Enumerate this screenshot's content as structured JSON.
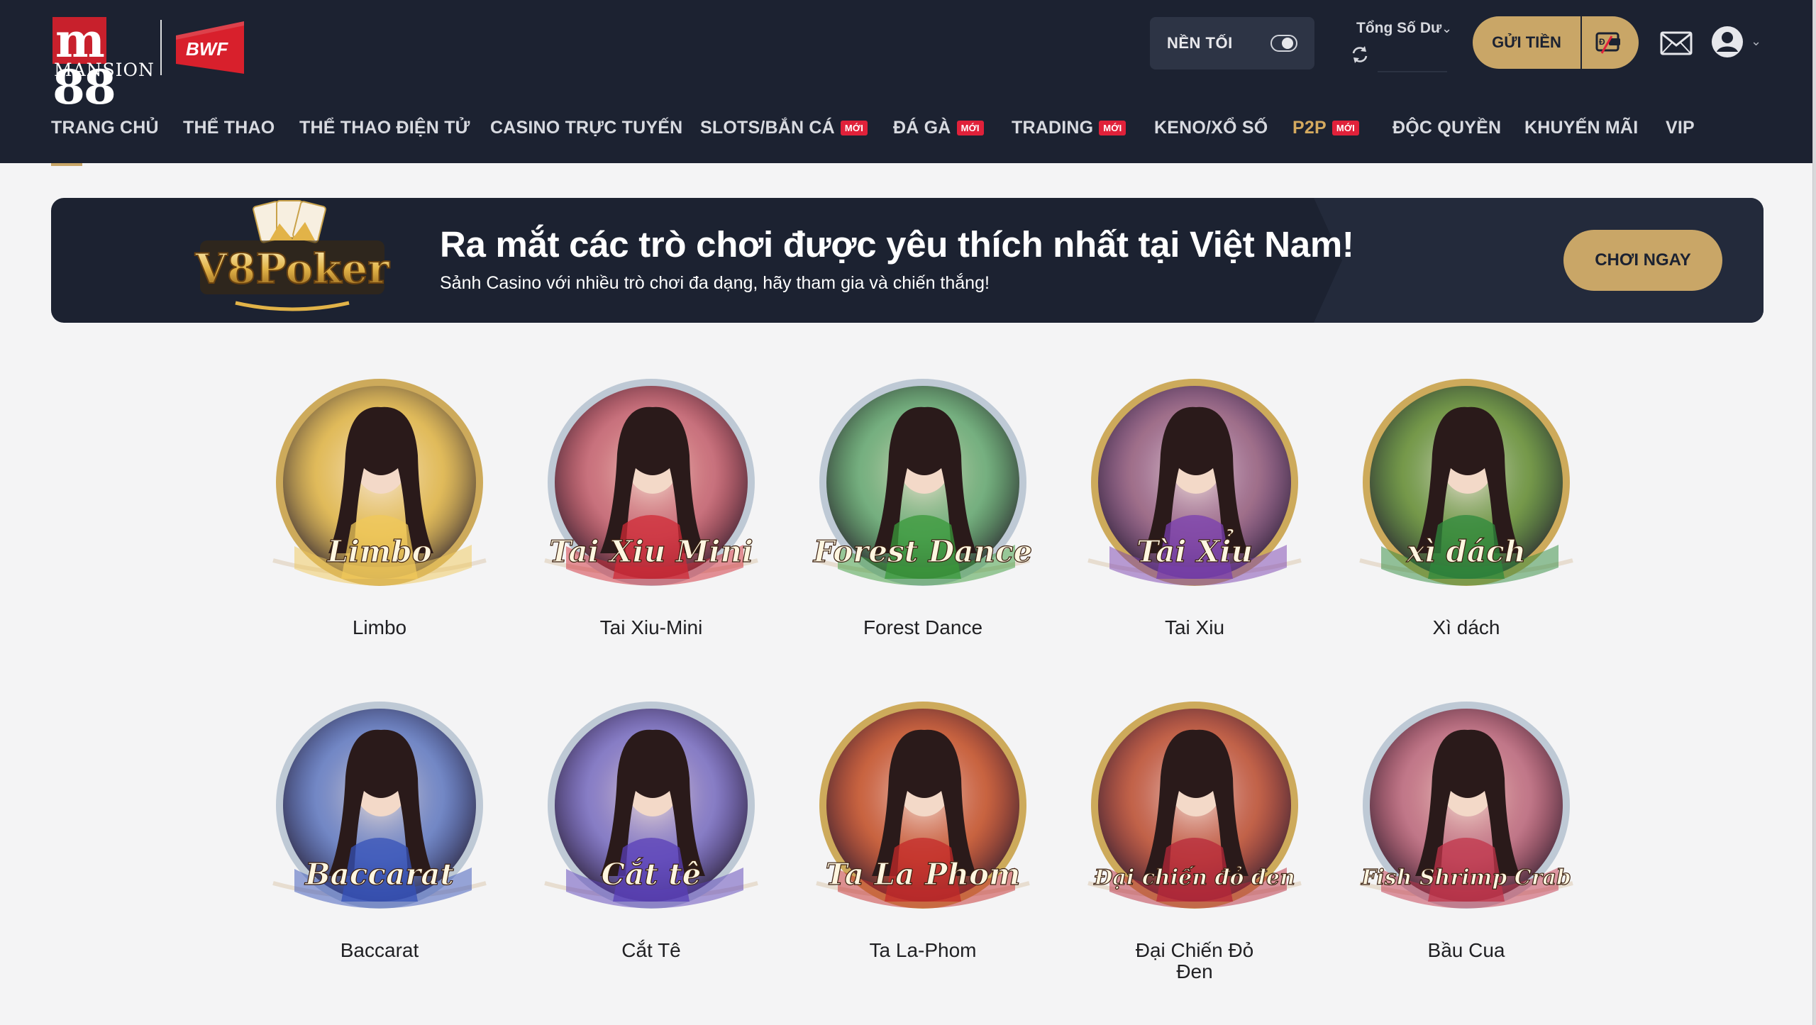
{
  "header": {
    "brand_main": "88",
    "brand_m": "m",
    "brand_sub": "MANSION",
    "partner_logo": "BWF",
    "dark_mode_label": "NỀN TỐI",
    "dark_mode_on": false,
    "balance_label": "Tổng Số Dư",
    "deposit_label": "GỬI TIỀN"
  },
  "nav": {
    "items": [
      {
        "label": "TRANG CHỦ",
        "new": false,
        "active": true
      },
      {
        "label": "THỂ THAO",
        "new": false
      },
      {
        "label": "THỂ THAO ĐIỆN TỬ",
        "new": false
      },
      {
        "label": "CASINO TRỰC TUYẾN",
        "new": false
      },
      {
        "label": "SLOTS/BẮN CÁ",
        "new": true
      },
      {
        "label": "ĐÁ GÀ",
        "new": true
      },
      {
        "label": "TRADING",
        "new": true
      },
      {
        "label": "KENO/XỔ SỐ",
        "new": false
      },
      {
        "label": "P2P",
        "new": true,
        "highlight": true
      },
      {
        "label": "ĐỘC QUYỀN",
        "new": false
      },
      {
        "label": "KHUYẾN MÃI",
        "new": false
      },
      {
        "label": "VIP",
        "new": false
      }
    ],
    "new_badge": "MỚI"
  },
  "banner": {
    "logo_text": "V8Poker",
    "headline": "Ra mắt các trò chơi được yêu thích nhất tại Việt Nam!",
    "subline": "Sảnh Casino với nhiều trò chơi đa dạng, hãy tham gia và chiến thắng!",
    "cta": "CHƠI NGAY"
  },
  "games": [
    {
      "name": "Limbo",
      "art_text": "Limbo",
      "ring": "#c9a24a",
      "glow": "#f0c85a"
    },
    {
      "name": "Tai Xiu-Mini",
      "art_text": "Tai Xiu Mini",
      "ring": "#b8c4d2",
      "glow": "#d02a35"
    },
    {
      "name": "Forest Dance",
      "art_text": "Forest Dance",
      "ring": "#b8c4d2",
      "glow": "#3a9a3a"
    },
    {
      "name": "Tai Xiu",
      "art_text": "Tài Xỉu",
      "ring": "#c9a24a",
      "glow": "#7a3fb0"
    },
    {
      "name": "Xì dách",
      "art_text": "xì dách",
      "ring": "#c9a24a",
      "glow": "#2e8a3c"
    },
    {
      "name": "Baccarat",
      "art_text": "Baccarat",
      "ring": "#b8c4d2",
      "glow": "#3552b8"
    },
    {
      "name": "Cắt Tê",
      "art_text": "Cắt tê",
      "ring": "#b8c4d2",
      "glow": "#5a3fb8"
    },
    {
      "name": "Ta La-Phom",
      "art_text": "Ta La Phom",
      "ring": "#c9a24a",
      "glow": "#c42a2a"
    },
    {
      "name": "Đại Chiến Đỏ Đen",
      "art_text": "Đại chiến đỏ đen",
      "ring": "#c9a24a",
      "glow": "#b8283a"
    },
    {
      "name": "Bầu Cua",
      "art_text": "Fish Shrimp Crab",
      "ring": "#b8c4d2",
      "glow": "#c2344a"
    }
  ]
}
